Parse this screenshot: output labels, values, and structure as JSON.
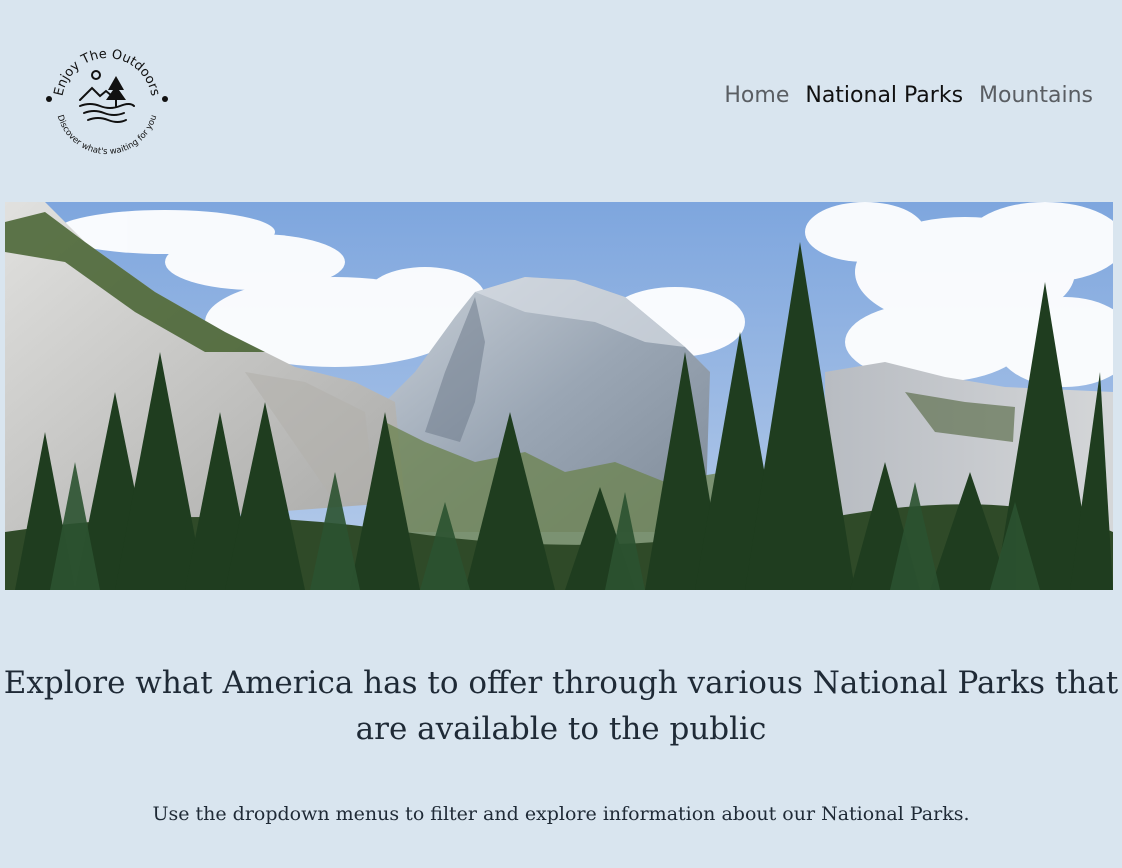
{
  "logo": {
    "top_text": "Enjoy The Outdoors",
    "bottom_text": "Discover what's waiting for you"
  },
  "nav": {
    "items": [
      {
        "label": "Home",
        "active": false
      },
      {
        "label": "National Parks",
        "active": true
      },
      {
        "label": "Mountains",
        "active": false
      }
    ]
  },
  "hero": {
    "subject": "mountain-landscape-with-pine-trees"
  },
  "main": {
    "headline": "Explore what America has to offer through various National Parks that are available to the public",
    "subtext": "Use the dropdown menus to filter and explore information about our National Parks."
  },
  "colors": {
    "page_background": "#d9e5ef",
    "text": "#1f2a36",
    "nav_inactive": "#5a5e63",
    "nav_active": "#111111"
  }
}
